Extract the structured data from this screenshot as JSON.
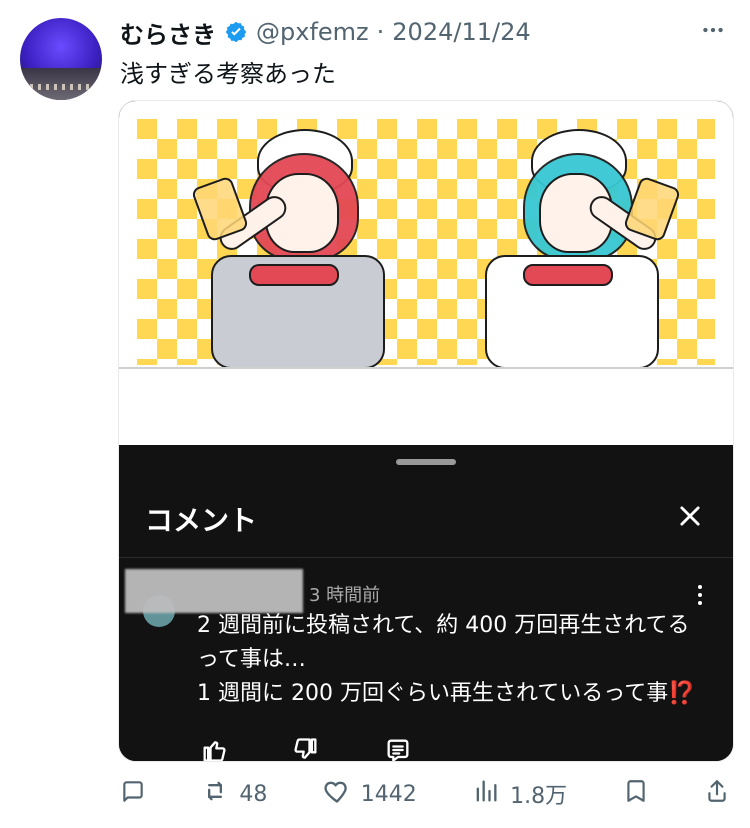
{
  "tweet": {
    "author": {
      "display_name": "むらさき",
      "handle": "@pxfemz",
      "date": "2024/11/24"
    },
    "text": "浅すぎる考察あった",
    "stats": {
      "retweets": "48",
      "likes": "1442",
      "views": "1.8万"
    }
  },
  "embedded_ui": {
    "panel_title": "コメント",
    "comment": {
      "time": "3 時間前",
      "text": "2 週間前に投稿されて、約 400 万回再生されてる\nって事は…\n1 週間に 200 万回ぐらい再生されているって事⁉️"
    }
  },
  "colors": {
    "x_gray": "#536471",
    "x_blue": "#1d9bf0",
    "dark_panel": "#121212"
  },
  "icons": {
    "verified": "verified-badge-icon",
    "more": "more-dots-icon",
    "close": "close-icon",
    "comment_kebab": "kebab-icon",
    "like": "thumbs-up-icon",
    "dislike": "thumbs-down-icon",
    "reply": "reply-box-icon",
    "tweet_reply": "reply-bubble-icon",
    "tweet_retweet": "retweet-icon",
    "tweet_like": "heart-icon",
    "tweet_views": "views-icon",
    "tweet_bookmark": "bookmark-icon",
    "tweet_share": "share-icon"
  }
}
